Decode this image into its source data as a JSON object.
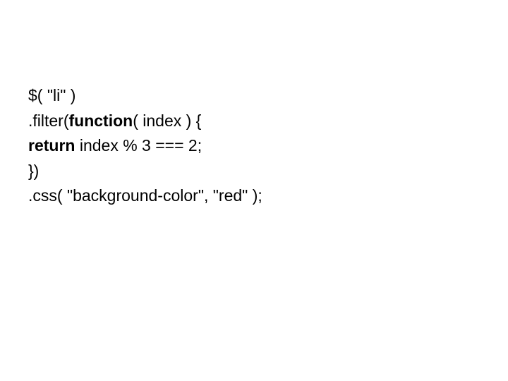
{
  "code": {
    "line1": "$( \"li\" )",
    "line2_part1": ".filter(",
    "line2_bold": "function",
    "line2_part2": "( index ) {",
    "line3_bold": "return",
    "line3_part2": " index % 3 === 2;",
    "line4": "})",
    "line5": ".css( \"background-color\", \"red\" );"
  }
}
